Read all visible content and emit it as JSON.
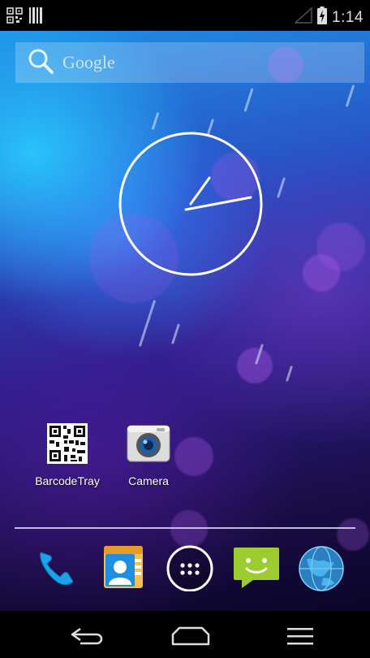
{
  "status_bar": {
    "time": "1:14",
    "icons": [
      "qr-code-icon",
      "barcode-icon",
      "signal-icon",
      "battery-charging-icon"
    ]
  },
  "search": {
    "label": "Google"
  },
  "home_apps": [
    {
      "label": "BarcodeTray",
      "icon": "qr-code-icon"
    },
    {
      "label": "Camera",
      "icon": "camera-icon"
    }
  ],
  "dock": [
    {
      "name": "phone",
      "icon": "phone-icon"
    },
    {
      "name": "contacts",
      "icon": "contacts-icon"
    },
    {
      "name": "apps",
      "icon": "app-drawer-icon"
    },
    {
      "name": "messaging",
      "icon": "messaging-icon"
    },
    {
      "name": "browser",
      "icon": "globe-icon"
    }
  ],
  "nav_bar": {
    "buttons": [
      "back-icon",
      "home-icon",
      "menu-icon"
    ]
  },
  "colors": {
    "accent_green": "#9ccc2f",
    "phone_blue": "#1aa3e8"
  }
}
